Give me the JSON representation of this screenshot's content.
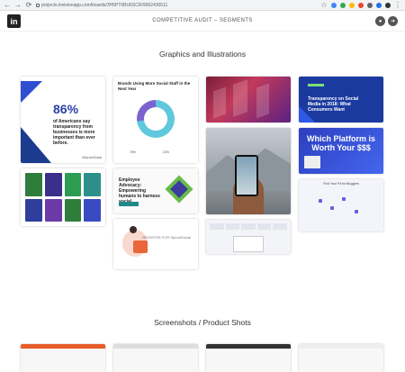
{
  "browser": {
    "url": "projects.invisionapp.com/boards/3H5PT6BU6SCR/9062430511",
    "nav": [
      "←",
      "→",
      "⟳"
    ]
  },
  "app": {
    "logo_text": "in",
    "title": "COMPETITIVE AUDIT – SEGMENTS"
  },
  "sections": {
    "graphics": "Graphics and Illustrations",
    "screenshots": "Screenshots / Product Shots"
  },
  "cards": {
    "stat_big": "86%",
    "stat_text": "of Americans say transparency from businesses is more important than ever before.",
    "stat_tag": "#SproutSocial",
    "donut_title": "Brands Using More Social Staff in the Next Year",
    "donut_leg_a": "76%",
    "donut_leg_b": "24%",
    "blue_title": "Transparency on Social Media in 2018: What Consumers Want",
    "emp_title": "Employee Advocacy: Empowering humans to harness social",
    "worth_title": "Which Platform is Worth Your $$$",
    "map_title": "Find Your Fit for Bloggers",
    "ill_label": "REGISTER FOR SproutSocial"
  },
  "colors": {
    "accent_blue": "#1a3a9f",
    "teal": "#5fc8dc",
    "purple": "#7b63d0"
  }
}
